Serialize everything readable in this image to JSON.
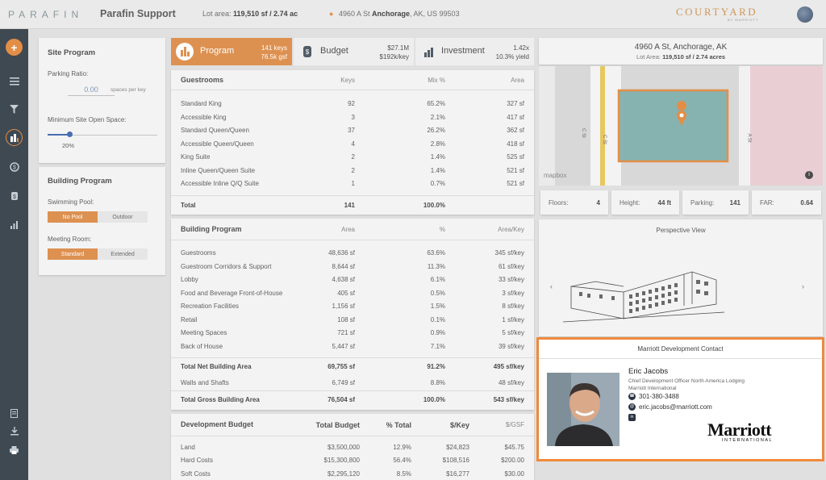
{
  "header": {
    "logo": "PARAFIN",
    "app_name": "Parafin Support",
    "lot_area_label": "Lot area:",
    "lot_area_value": "119,510 sf / 2.74 ac",
    "address_street": "4960 A St",
    "address_city": "Anchorage",
    "address_rest": ", AK, US 99503",
    "brand": "COURTYARD",
    "brand_sub": "BY MARRIOTT"
  },
  "sidebar_icons": [
    "add-icon",
    "list-icon",
    "filter-icon",
    "program-icon",
    "budget-icon",
    "investment-icon",
    "chart-icon",
    "report-icon",
    "download-icon",
    "print-icon"
  ],
  "site_program": {
    "title": "Site Program",
    "parking_ratio_label": "Parking Ratio:",
    "parking_ratio_value": "0.00",
    "parking_ratio_unit": "spaces per key",
    "open_space_label": "Minimum Site Open Space:",
    "open_space_value": "20%",
    "open_space_fraction": 0.2
  },
  "building_program_card": {
    "title": "Building Program",
    "pool_label": "Swimming Pool:",
    "pool_options": [
      "No Pool",
      "Outdoor"
    ],
    "meeting_label": "Meeting Room:",
    "meeting_options": [
      "Standard",
      "Extended"
    ]
  },
  "tabs": {
    "program": {
      "label": "Program",
      "line1": "141 keys",
      "line2": "76.5k gsf"
    },
    "budget": {
      "label": "Budget",
      "line1": "$27.1M",
      "line2": "$192k/key"
    },
    "investment": {
      "label": "Investment",
      "line1": "1.42x",
      "line2": "10.3% yield"
    }
  },
  "guestrooms": {
    "headers": [
      "Guestrooms",
      "Keys",
      "Mix %",
      "Area"
    ],
    "rows": [
      [
        "Standard King",
        "92",
        "65.2%",
        "327 sf"
      ],
      [
        "Accessible King",
        "3",
        "2.1%",
        "417 sf"
      ],
      [
        "Standard Queen/Queen",
        "37",
        "26.2%",
        "362 sf"
      ],
      [
        "Accessible Queen/Queen",
        "4",
        "2.8%",
        "418 sf"
      ],
      [
        "King Suite",
        "2",
        "1.4%",
        "525 sf"
      ],
      [
        "Inline Queen/Queen Suite",
        "2",
        "1.4%",
        "521 sf"
      ],
      [
        "Accessible Inline Q/Q Suite",
        "1",
        "0.7%",
        "521 sf"
      ]
    ],
    "total": [
      "Total",
      "141",
      "100.0%",
      ""
    ]
  },
  "building_program": {
    "headers": [
      "Building Program",
      "Area",
      "%",
      "Area/Key"
    ],
    "rows": [
      [
        "Guestrooms",
        "48,636 sf",
        "63.6%",
        "345 sf/key"
      ],
      [
        "Guestroom Corridors & Support",
        "8,644 sf",
        "11.3%",
        "61 sf/key"
      ],
      [
        "Lobby",
        "4,638 sf",
        "6.1%",
        "33 sf/key"
      ],
      [
        "Food and Beverage Front-of-House",
        "405 sf",
        "0.5%",
        "3 sf/key"
      ],
      [
        "Recreation Facilities",
        "1,156 sf",
        "1.5%",
        "8 sf/key"
      ],
      [
        "Retail",
        "108 sf",
        "0.1%",
        "1 sf/key"
      ],
      [
        "Meeting Spaces",
        "721 sf",
        "0.9%",
        "5 sf/key"
      ],
      [
        "Back of House",
        "5,447 sf",
        "7.1%",
        "39 sf/key"
      ]
    ],
    "net": [
      "Total Net Building Area",
      "69,755 sf",
      "91.2%",
      "495 sf/key"
    ],
    "walls": [
      "Walls and Shafts",
      "6,749 sf",
      "8.8%",
      "48 sf/key"
    ],
    "gross": [
      "Total Gross Building Area",
      "76,504 sf",
      "100.0%",
      "543 sf/key"
    ]
  },
  "development_budget": {
    "headers": [
      "Development Budget",
      "Total Budget",
      "% Total",
      "$/Key",
      "$/GSF"
    ],
    "rows": [
      [
        "Land",
        "$3,500,000",
        "12.9%",
        "$24,823",
        "$45.75"
      ],
      [
        "Hard Costs",
        "$15,300,800",
        "56.4%",
        "$108,516",
        "$200.00"
      ],
      [
        "Soft Costs",
        "$2,295,120",
        "8.5%",
        "$16,277",
        "$30.00"
      ]
    ]
  },
  "site_card": {
    "address": "4960 A St, Anchorage, AK",
    "lot_area_label": "Lot Area:",
    "lot_area_value": "119,510 sf / 2.74 acres",
    "street_labels": [
      "C St",
      "C St",
      "A St"
    ],
    "map_attribution": "mapbox"
  },
  "stats": [
    {
      "label": "Floors:",
      "value": "4"
    },
    {
      "label": "Height:",
      "value": "44 ft"
    },
    {
      "label": "Parking:",
      "value": "141"
    },
    {
      "label": "FAR:",
      "value": "0.64"
    }
  ],
  "perspective": {
    "title": "Perspective View"
  },
  "contact": {
    "header": "Marriott Development Contact",
    "name": "Eric Jacobs",
    "title": "Chief Development Officer North America Lodging",
    "company": "Marriott International",
    "phone": "301-380-3488",
    "email": "eric.jacobs@marriott.com",
    "logo_text": "Marriott",
    "logo_sub": "INTERNATIONAL"
  }
}
